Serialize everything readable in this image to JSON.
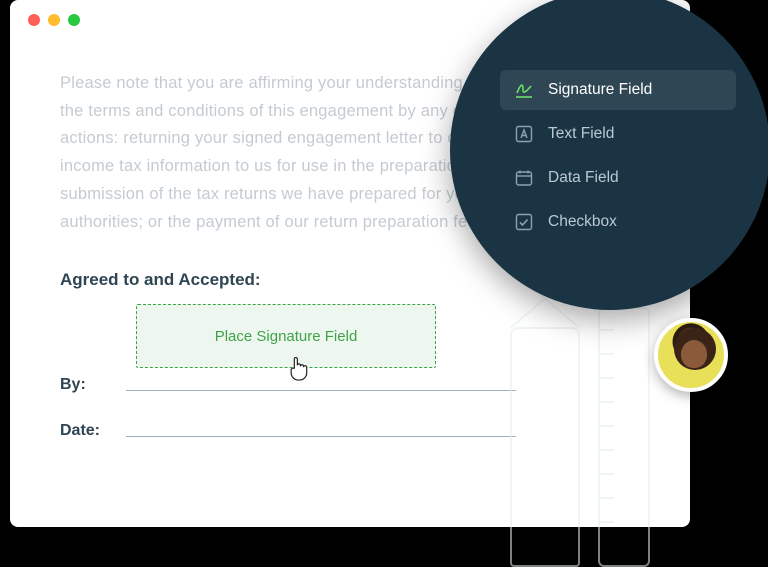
{
  "document": {
    "body_text": "Please note that you are affirming your understanding of, and agreement to, the terms and conditions of this engagement by any one of the following actions: returning your signed engagement letter to our firm; returning your income tax information to us for use in the preparation of your returns; the submission of the tax returns we have prepared for you to the taxing authorities; or the payment of our return preparation fees.",
    "agreed_heading": "Agreed to and Accepted:",
    "signature_placeholder": "Place Signature Field",
    "by_label": "By:",
    "date_label": "Date:"
  },
  "menu": {
    "options": [
      {
        "id": "signature",
        "label": "Signature Field",
        "icon": "signature-icon",
        "active": true
      },
      {
        "id": "text",
        "label": "Text Field",
        "icon": "text-icon",
        "active": false
      },
      {
        "id": "data",
        "label": "Data Field",
        "icon": "calendar-icon",
        "active": false
      },
      {
        "id": "checkbox",
        "label": "Checkbox",
        "icon": "checkbox-icon",
        "active": false
      }
    ]
  },
  "colors": {
    "circle_bg": "#1b3444",
    "accent_green": "#3fa24a",
    "text_heading": "#2f4553"
  }
}
